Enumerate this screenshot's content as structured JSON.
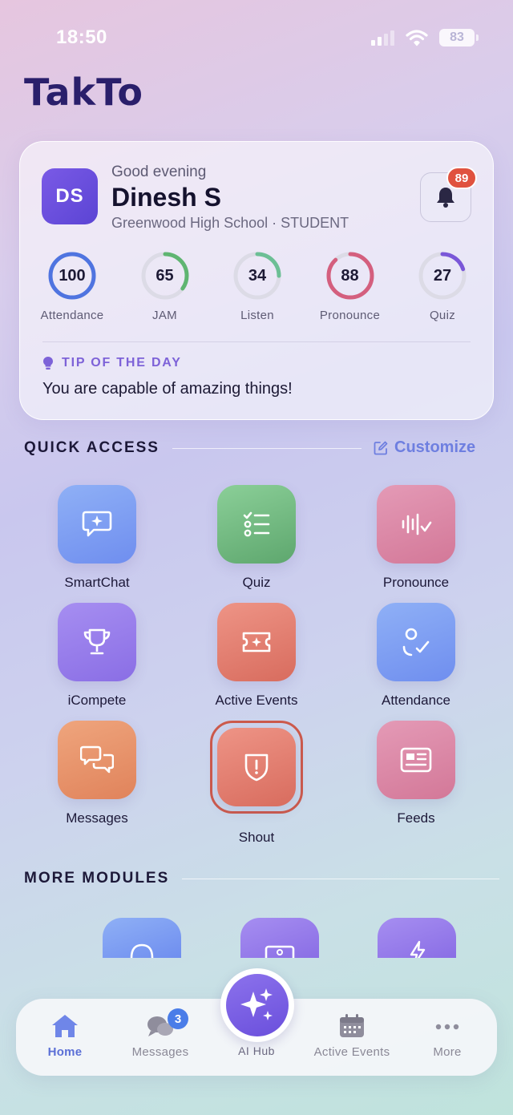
{
  "status_bar": {
    "time": "18:50",
    "battery": "83"
  },
  "app": {
    "logo": "TakTo"
  },
  "profile": {
    "initials": "DS",
    "greeting": "Good evening",
    "name": "Dinesh S",
    "school_line": "Greenwood High School · STUDENT",
    "notification_count": "89",
    "bell_icon": "bell-icon"
  },
  "stats": [
    {
      "value": "100",
      "label": "Attendance",
      "progress": 1.0,
      "color": "#4f74e0"
    },
    {
      "value": "65",
      "label": "JAM",
      "progress": 0.35,
      "color": "#5fb571"
    },
    {
      "value": "34",
      "label": "Listen",
      "progress": 0.25,
      "color": "#6cbf95"
    },
    {
      "value": "88",
      "label": "Pronounce",
      "progress": 0.88,
      "color": "#d45f7e"
    },
    {
      "value": "27",
      "label": "Quiz",
      "progress": 0.2,
      "color": "#7a57d8"
    }
  ],
  "tip": {
    "title": "TIP OF THE DAY",
    "text": "You are capable of amazing things!",
    "icon": "bulb-icon"
  },
  "quick_access": {
    "title": "QUICK ACCESS",
    "customize_label": "Customize",
    "items": [
      {
        "label": "SmartChat",
        "icon": "chat-sparkle-icon"
      },
      {
        "label": "Quiz",
        "icon": "checklist-icon"
      },
      {
        "label": "Pronounce",
        "icon": "waveform-check-icon"
      },
      {
        "label": "iCompete",
        "icon": "trophy-icon"
      },
      {
        "label": "Active Events",
        "icon": "ticket-icon"
      },
      {
        "label": "Attendance",
        "icon": "person-check-icon"
      },
      {
        "label": "Messages",
        "icon": "chat-bubbles-icon"
      },
      {
        "label": "Shout",
        "icon": "shield-alert-icon"
      },
      {
        "label": "Feeds",
        "icon": "newspaper-icon"
      }
    ]
  },
  "more_modules": {
    "title": "MORE MODULES"
  },
  "bottom_nav": {
    "items": [
      {
        "label": "Home",
        "icon": "home-icon",
        "active": true
      },
      {
        "label": "Messages",
        "icon": "chat-bubbles-icon",
        "badge": "3"
      },
      {
        "label": "AI Hub",
        "icon": "sparkles-icon"
      },
      {
        "label": "Active Events",
        "icon": "calendar-icon"
      },
      {
        "label": "More",
        "icon": "more-dots-icon"
      }
    ]
  }
}
